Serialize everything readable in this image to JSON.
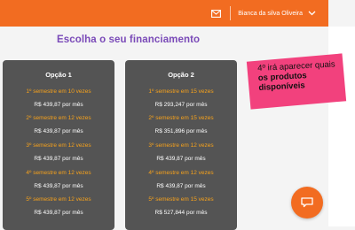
{
  "header": {
    "user_name": "Bianca da silva Oliveira",
    "accent": "#f26c21",
    "icons": [
      "mail-icon",
      "chevron-down-icon"
    ]
  },
  "title": "Escolha o seu financiamento",
  "options": [
    {
      "title": "Opção 1",
      "lines": [
        {
          "semester": "1º semestre em 10 vezes",
          "price": "R$ 439,87 por mês"
        },
        {
          "semester": "2º semestre em 12 vezes",
          "price": "R$ 439,87 por mês"
        },
        {
          "semester": "3º semestre em 12 vezes",
          "price": "R$ 439,87 por mês"
        },
        {
          "semester": "4º semestre em 12 vezes",
          "price": "R$ 439,87 por mês"
        },
        {
          "semester": "5º semestre em 12 vezes",
          "price": "R$ 439,87 por mês"
        }
      ]
    },
    {
      "title": "Opção 2",
      "lines": [
        {
          "semester": "1º semestre em 15 vezes",
          "price": "R$ 293,247 por mês"
        },
        {
          "semester": "2º semestre em 15 vezes",
          "price": "R$ 351,896 por mês"
        },
        {
          "semester": "3º semestre em 12 vezes",
          "price": "R$ 439,87 por mês"
        },
        {
          "semester": "4º semestre em 12 vezes",
          "price": "R$ 439,87 por mês"
        },
        {
          "semester": "5º semestre em 15 vezes",
          "price": "R$ 527,844 por mês"
        }
      ]
    }
  ],
  "annotation": {
    "text_plain": "4º irá aparecer quais",
    "text_bold": "os produtos disponíveis",
    "color": "#f2417d"
  },
  "chat": {
    "icon": "chat-icon"
  }
}
